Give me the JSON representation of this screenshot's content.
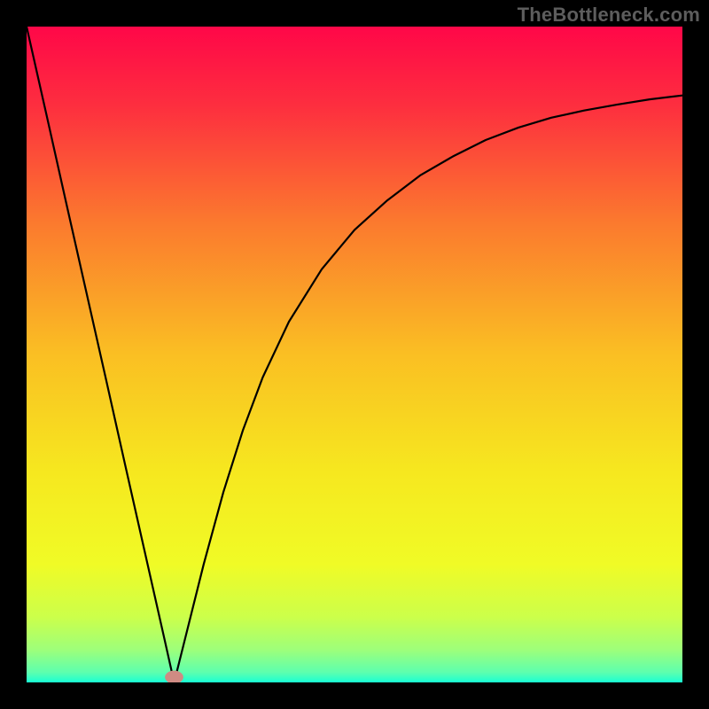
{
  "watermark": "TheBottleneck.com",
  "chart_data": {
    "type": "line",
    "title": "",
    "xlabel": "",
    "ylabel": "",
    "xlim": [
      0,
      100
    ],
    "ylim": [
      0,
      100
    ],
    "grid": false,
    "background": {
      "type": "vertical_gradient",
      "stops": [
        {
          "pos": 0.0,
          "color": "#ff0748"
        },
        {
          "pos": 0.12,
          "color": "#fd2e3f"
        },
        {
          "pos": 0.3,
          "color": "#fb7a2e"
        },
        {
          "pos": 0.5,
          "color": "#fabf23"
        },
        {
          "pos": 0.68,
          "color": "#f6e81f"
        },
        {
          "pos": 0.82,
          "color": "#f0fb26"
        },
        {
          "pos": 0.9,
          "color": "#ccff4a"
        },
        {
          "pos": 0.95,
          "color": "#9eff7a"
        },
        {
          "pos": 0.985,
          "color": "#5cffaf"
        },
        {
          "pos": 1.0,
          "color": "#18ffd4"
        }
      ]
    },
    "series": [
      {
        "name": "curve",
        "color": "#000000",
        "stroke_width": 2.2,
        "x": [
          0,
          3,
          6,
          9,
          12,
          15,
          18,
          21,
          22.5,
          24,
          27,
          30,
          33,
          36,
          40,
          45,
          50,
          55,
          60,
          65,
          70,
          75,
          80,
          85,
          90,
          95,
          100
        ],
        "values": [
          100,
          86.7,
          73.3,
          60.0,
          46.7,
          33.3,
          20.0,
          6.7,
          0.0,
          6.0,
          18.0,
          29.0,
          38.5,
          46.5,
          55.0,
          63.0,
          69.0,
          73.5,
          77.3,
          80.2,
          82.7,
          84.6,
          86.1,
          87.2,
          88.1,
          88.9,
          89.5
        ]
      }
    ],
    "markers": [
      {
        "name": "min-marker",
        "x": 22.5,
        "y": 0.8,
        "rx": 1.4,
        "ry": 1.0,
        "fill": "#cf8b83"
      }
    ]
  }
}
